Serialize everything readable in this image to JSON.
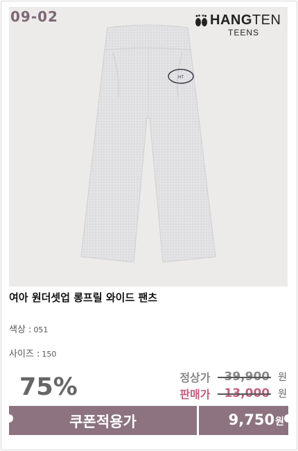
{
  "product": {
    "code": "09-02",
    "brand": {
      "name_main": "HANG",
      "name_rest": "TEN",
      "sub": "TEENS",
      "logo_icon": "feet-icon"
    },
    "title": "여아 원더셋업 롱프릴 와이드 팬츠",
    "color": {
      "label": "색상 :",
      "value": "051"
    },
    "size": {
      "label": "사이즈 :",
      "value": "150"
    }
  },
  "pricing": {
    "discount": "75%",
    "regular": {
      "label": "정상가",
      "value": "39,900",
      "unit": "원"
    },
    "sale": {
      "label": "판매가",
      "value": "13,000",
      "unit": "원"
    },
    "coupon_label": "쿠폰적용가",
    "final_value": "9,750",
    "final_unit": "원"
  },
  "colors": {
    "accent": "#8c737f",
    "sale": "#c05e7e",
    "photo_bg": "#ecebe9"
  }
}
